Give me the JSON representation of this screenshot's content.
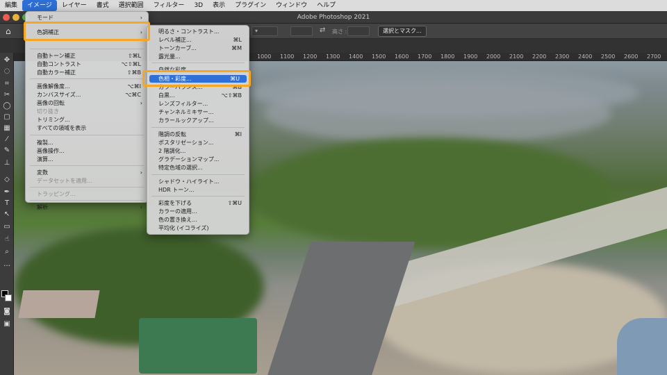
{
  "menubar": {
    "items": [
      "編集",
      "イメージ",
      "レイヤー",
      "書式",
      "選択範囲",
      "フィルター",
      "3D",
      "表示",
      "プラグイン",
      "ウィンドウ",
      "ヘルプ"
    ],
    "active_index": 1
  },
  "window": {
    "title": "Adobe Photoshop 2021"
  },
  "optionsbar": {
    "select_mask": "選択とマスク...",
    "height_label": "高さ :"
  },
  "ruler": {
    "ticks": [
      "1000",
      "1100",
      "1200",
      "1300",
      "1400",
      "1500",
      "1600",
      "1700",
      "1800",
      "1900",
      "2000",
      "2100",
      "2200",
      "2300",
      "2400",
      "2500",
      "2600",
      "2700"
    ]
  },
  "image_menu": {
    "items": [
      {
        "label": "モード",
        "shortcut": "",
        "submenu": true,
        "disabled": false
      },
      {
        "label": "色調補正",
        "shortcut": "",
        "submenu": true,
        "disabled": false,
        "highlight": true
      },
      {
        "label": "自動トーン補正",
        "shortcut": "⇧⌘L",
        "submenu": false,
        "disabled": false
      },
      {
        "label": "自動コントラスト",
        "shortcut": "⌥⇧⌘L",
        "submenu": false,
        "disabled": false
      },
      {
        "label": "自動カラー補正",
        "shortcut": "⇧⌘B",
        "submenu": false,
        "disabled": false
      },
      {
        "label": "画像解像度...",
        "shortcut": "⌥⌘I",
        "submenu": false,
        "disabled": false
      },
      {
        "label": "カンバスサイズ...",
        "shortcut": "⌥⌘C",
        "submenu": false,
        "disabled": false
      },
      {
        "label": "画像の回転",
        "shortcut": "",
        "submenu": true,
        "disabled": false
      },
      {
        "label": "切り抜き",
        "shortcut": "",
        "submenu": false,
        "disabled": true
      },
      {
        "label": "トリミング...",
        "shortcut": "",
        "submenu": false,
        "disabled": false
      },
      {
        "label": "すべての領域を表示",
        "shortcut": "",
        "submenu": false,
        "disabled": false
      },
      {
        "label": "複製...",
        "shortcut": "",
        "submenu": false,
        "disabled": false
      },
      {
        "label": "画像操作...",
        "shortcut": "",
        "submenu": false,
        "disabled": false
      },
      {
        "label": "演算...",
        "shortcut": "",
        "submenu": false,
        "disabled": false
      },
      {
        "label": "変数",
        "shortcut": "",
        "submenu": true,
        "disabled": false
      },
      {
        "label": "データセットを適用...",
        "shortcut": "",
        "submenu": false,
        "disabled": true
      },
      {
        "label": "トラッピング...",
        "shortcut": "",
        "submenu": false,
        "disabled": true
      },
      {
        "label": "解析",
        "shortcut": "",
        "submenu": true,
        "disabled": false
      }
    ]
  },
  "adjust_menu": {
    "items": [
      {
        "label": "明るさ・コントラスト...",
        "shortcut": ""
      },
      {
        "label": "レベル補正...",
        "shortcut": "⌘L"
      },
      {
        "label": "トーンカーブ...",
        "shortcut": "⌘M"
      },
      {
        "label": "露光量...",
        "shortcut": ""
      },
      {
        "label": "自然な彩度...",
        "shortcut": ""
      },
      {
        "label": "色相・彩度...",
        "shortcut": "⌘U",
        "highlight": true
      },
      {
        "label": "カラーバランス...",
        "shortcut": "⌘B"
      },
      {
        "label": "白黒...",
        "shortcut": "⌥⇧⌘B"
      },
      {
        "label": "レンズフィルター...",
        "shortcut": ""
      },
      {
        "label": "チャンネルミキサー...",
        "shortcut": ""
      },
      {
        "label": "カラールックアップ...",
        "shortcut": ""
      },
      {
        "label": "階調の反転",
        "shortcut": "⌘I"
      },
      {
        "label": "ポスタリゼーション...",
        "shortcut": ""
      },
      {
        "label": "2 階調化...",
        "shortcut": ""
      },
      {
        "label": "グラデーションマップ...",
        "shortcut": ""
      },
      {
        "label": "特定色域の選択...",
        "shortcut": ""
      },
      {
        "label": "シャドウ・ハイライト...",
        "shortcut": ""
      },
      {
        "label": "HDR トーン...",
        "shortcut": ""
      },
      {
        "label": "彩度を下げる",
        "shortcut": "⇧⌘U"
      },
      {
        "label": "カラーの適用...",
        "shortcut": ""
      },
      {
        "label": "色の置き換え...",
        "shortcut": ""
      },
      {
        "label": "平均化 (イコライズ)",
        "shortcut": ""
      }
    ]
  },
  "colors": {
    "callout": "#f5a623",
    "highlight": "#2f6fd8"
  }
}
